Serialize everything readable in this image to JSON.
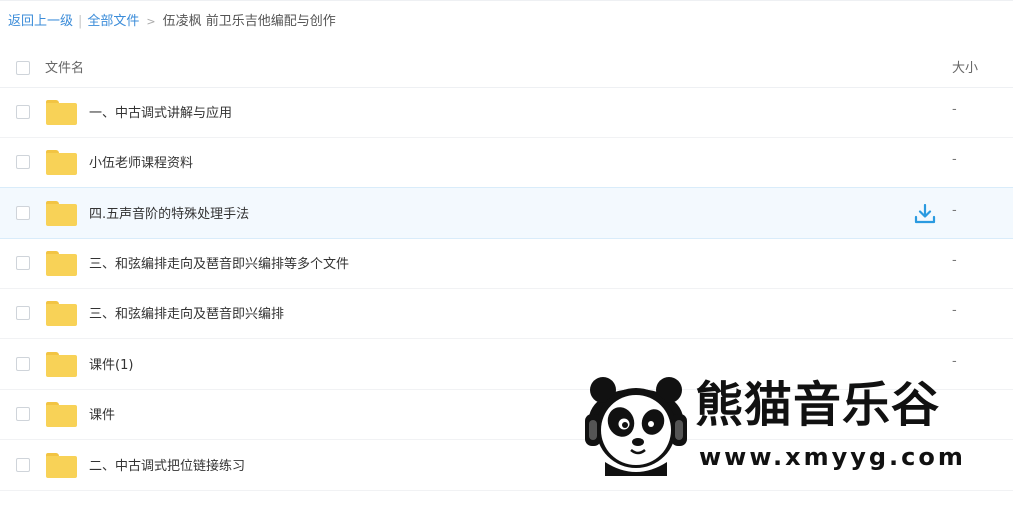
{
  "breadcrumb": {
    "back": "返回上一级",
    "separator": "|",
    "all_files": "全部文件",
    "arrow": ">",
    "current": "伍凌枫 前卫乐吉他编配与创作"
  },
  "table": {
    "col_name": "文件名",
    "col_size": "大小",
    "rows": [
      {
        "name": "一、中古调式讲解与应用",
        "size": "-"
      },
      {
        "name": "小伍老师课程资料",
        "size": "-"
      },
      {
        "name": "四.五声音阶的特殊处理手法",
        "size": "-"
      },
      {
        "name": "三、和弦编排走向及琶音即兴编排等多个文件",
        "size": "-"
      },
      {
        "name": "三、和弦编排走向及琶音即兴编排",
        "size": "-"
      },
      {
        "name": "课件(1)",
        "size": "-"
      },
      {
        "name": "课件",
        "size": ""
      },
      {
        "name": "二、中古调式把位链接练习",
        "size": ""
      }
    ]
  },
  "watermark": {
    "title": "熊猫音乐谷",
    "url": "www.xmyyg.com"
  },
  "colors": {
    "link": "#3b8cd9",
    "folder": "#f8d257",
    "highlight": "#f3f9fe",
    "download_icon": "#2a9ae0"
  },
  "icons": {
    "folder": "folder-icon",
    "download": "download-icon",
    "logo": "panda-logo"
  }
}
